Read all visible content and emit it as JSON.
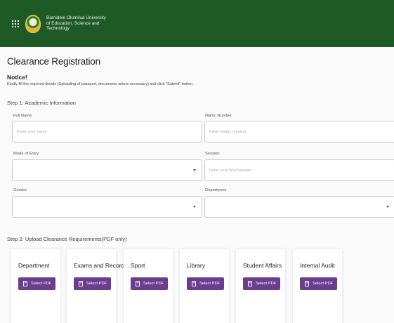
{
  "header": {
    "university_lines": [
      "Bamidele Olumilua University",
      "of Education, Science and",
      "Technology"
    ]
  },
  "page": {
    "title": "Clearance Registration",
    "notice_title": "Notice!",
    "notice_text": "Kindly fill the required details (Uploading of passport, documents where necessary) and click \"Submit\" button."
  },
  "step1": {
    "title": "Step 1: Academic Information",
    "full_name": {
      "label": "Full Name",
      "placeholder": "Enter your name",
      "value": ""
    },
    "matric_number": {
      "label": "Matric Number",
      "placeholder": "Enter matric number",
      "value": ""
    },
    "mode_of_entry": {
      "label": "Mode of Entry",
      "selected": ""
    },
    "session": {
      "label": "Session",
      "placeholder": "Enter your final session",
      "value": ""
    },
    "gender": {
      "label": "Gender",
      "selected": ""
    },
    "department": {
      "label": "Department",
      "selected": ""
    }
  },
  "step2": {
    "title": "Step 2: Upload Clearance Requirements(PDF only)",
    "cards": [
      {
        "title": "Department",
        "button": "Select PDF"
      },
      {
        "title": "Exams and Record",
        "button": "Select PDF"
      },
      {
        "title": "Sport",
        "button": "Select PDF"
      },
      {
        "title": "Library",
        "button": "Select PDF"
      },
      {
        "title": "Student Affairs",
        "button": "Select PDF"
      },
      {
        "title": "Internal Audit",
        "button": "Select PDF"
      }
    ]
  },
  "icons": {
    "menu": "grid-menu-icon",
    "logo": "university-logo",
    "caret": "chevron-down-icon",
    "file": "file-plus-icon"
  },
  "colors": {
    "header": "#1d5a25",
    "button": "#6b3d8f"
  }
}
